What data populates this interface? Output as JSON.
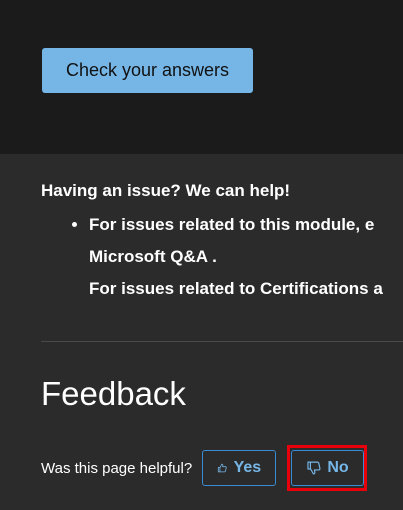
{
  "quiz": {
    "check_button_label": "Check your answers"
  },
  "help": {
    "title": "Having an issue? We can help!",
    "items": [
      {
        "line1": "For issues related to this module, e",
        "line2": "Microsoft Q&A ."
      },
      {
        "line1": "For issues related to Certifications a"
      }
    ]
  },
  "feedback": {
    "heading": "Feedback",
    "question": "Was this page helpful?",
    "yes_label": "Yes",
    "no_label": "No"
  },
  "colors": {
    "top_panel_bg": "#1b1b1b",
    "page_bg": "#2b2b2b",
    "accent": "#75b6e7",
    "highlight": "#e8000b"
  },
  "icons": {
    "yes": "thumbs-up-icon",
    "no": "thumbs-down-icon"
  }
}
